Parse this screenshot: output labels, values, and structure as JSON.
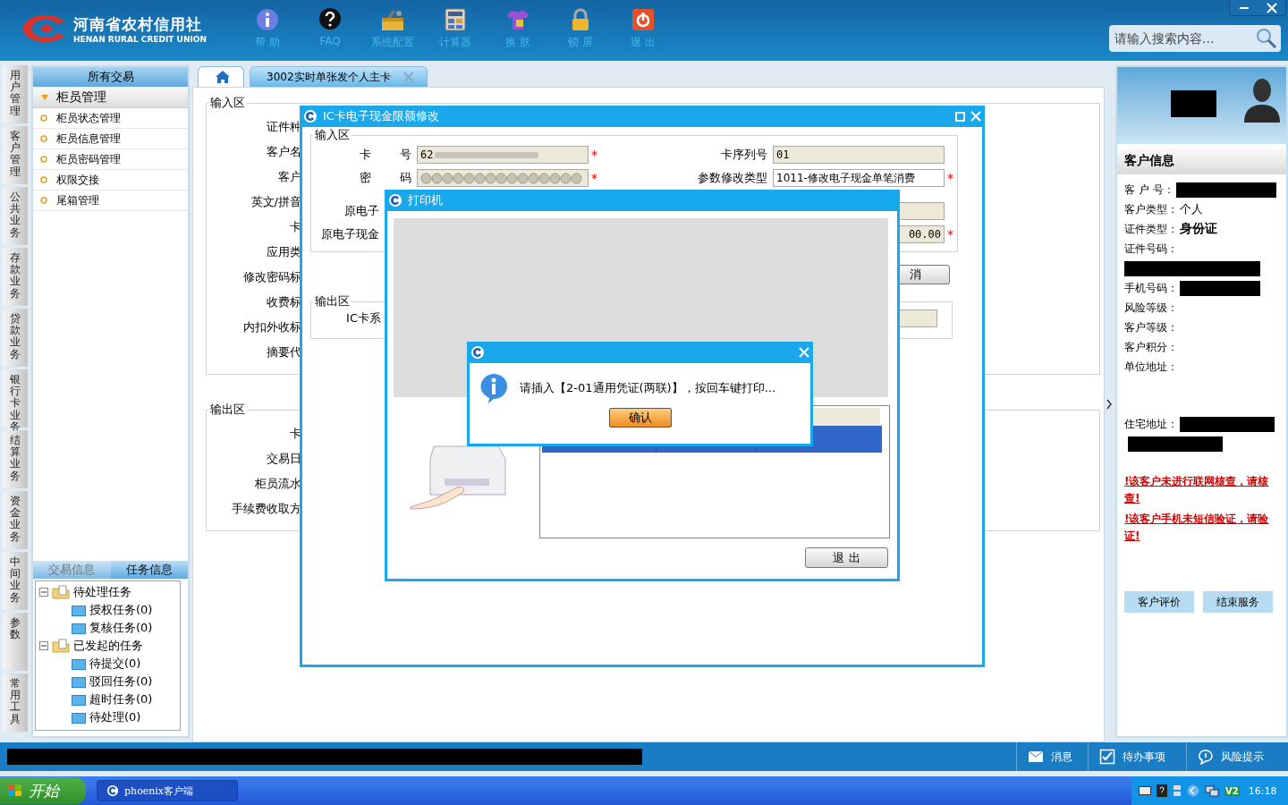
{
  "app": {
    "logo_cn": "河南省农村信用社",
    "logo_en": "HENAN RURAL CREDIT UNION"
  },
  "toolbar": [
    {
      "label": "帮 助",
      "kind": "info"
    },
    {
      "label": "FAQ",
      "kind": "faq"
    },
    {
      "label": "系统配置",
      "kind": "config"
    },
    {
      "label": "计算器",
      "kind": "calculator"
    },
    {
      "label": "换 肤",
      "kind": "skin"
    },
    {
      "label": "锁 屏",
      "kind": "lock"
    },
    {
      "label": "退 出",
      "kind": "exit"
    }
  ],
  "search": {
    "placeholder": "请输入搜索内容..."
  },
  "nav_tabs": [
    {
      "label": "用户管理"
    },
    {
      "label": "客户管理"
    },
    {
      "label": "公共业务"
    },
    {
      "label": "存款业务"
    },
    {
      "label": "贷款业务"
    },
    {
      "label": "银行卡业务"
    },
    {
      "label": "结算业务"
    },
    {
      "label": "资金业务"
    },
    {
      "label": "中间业务"
    },
    {
      "label": "参数"
    },
    {
      "label": "常用工具"
    }
  ],
  "sidebar": {
    "title": "所有交易",
    "groups": [
      {
        "label": "柜员管理",
        "expanded": true,
        "items": [
          {
            "label": "柜员状态管理"
          },
          {
            "label": "柜员信息管理"
          },
          {
            "label": "柜员密码管理"
          },
          {
            "label": "权限交接"
          },
          {
            "label": "尾箱管理"
          }
        ]
      }
    ]
  },
  "task_panel": {
    "tabs": [
      {
        "label": "交易信息",
        "selected": false
      },
      {
        "label": "任务信息",
        "selected": true
      }
    ],
    "tree": [
      {
        "label": "待处理任务",
        "expanded": true,
        "children": [
          {
            "label": "授权任务(0)"
          },
          {
            "label": "复核任务(0)"
          }
        ]
      },
      {
        "label": "已发起的任务",
        "expanded": true,
        "children": [
          {
            "label": "待提交(0)"
          },
          {
            "label": "驳回任务(0)"
          },
          {
            "label": "超时任务(0)"
          },
          {
            "label": "待处理(0)"
          }
        ]
      }
    ]
  },
  "doc_tabs": [
    {
      "kind": "home",
      "selected": false
    },
    {
      "kind": "page",
      "label": "3002实时单张发个人主卡",
      "selected": true
    }
  ],
  "form": {
    "input_legend": "输入区",
    "input_labels": [
      "证件种",
      "客户名",
      "客户",
      "英文/拼音",
      "卡",
      "应用类",
      "修改密码标",
      "收费标",
      "内扣外收标",
      "摘要代"
    ],
    "output_legend": "输出区",
    "output_labels": [
      "卡",
      "交易日",
      "柜员流水",
      "手续费收取方"
    ]
  },
  "card_dialog": {
    "title": "IC卡电子现金限额修改",
    "input_legend": "输入区",
    "fields": [
      {
        "label": "卡 号",
        "spaced": true,
        "kind": "blurred",
        "value": "62",
        "required": "*"
      },
      {
        "label": "卡序列号",
        "kind": "text",
        "value": "01"
      },
      {
        "label": "密 码",
        "spaced": true,
        "kind": "password",
        "required": "*"
      },
      {
        "label": "参数修改类型",
        "kind": "select",
        "value": "1011-修改电子现金单笔消费",
        "required": "*"
      },
      {
        "label": "原电子",
        "kind": "label_only"
      },
      {
        "kind": "text"
      },
      {
        "label": "原电子现金",
        "kind": "label_only"
      },
      {
        "kind": "amount",
        "value": "00.00",
        "required": "*"
      }
    ],
    "button": "消",
    "output_legend": "输出区",
    "output_label": "IC卡系"
  },
  "printer_dialog": {
    "title": "打印机",
    "list_rows": [
      {
        "selected": true
      }
    ],
    "exit_button": "退 出"
  },
  "message_box": {
    "message": "请插入【2-01通用凭证(两联)】，按回车键打印...",
    "ok_button": "确认"
  },
  "customer": {
    "title": "客户信息",
    "rows": [
      {
        "label": "客 户 号：",
        "kind": "redacted"
      },
      {
        "label": "客户类型：",
        "kind": "plain",
        "value": "个人"
      },
      {
        "label": "证件类型：",
        "kind": "bold",
        "value": "身份证"
      },
      {
        "label": "证件号码：",
        "kind": "redacted_below"
      },
      {
        "label": "手机号码：",
        "kind": "redacted"
      },
      {
        "label": "风险等级：",
        "kind": "blank"
      },
      {
        "label": "客户等级：",
        "kind": "blank"
      },
      {
        "label": "客户积分：",
        "kind": "blank"
      },
      {
        "label": "单位地址：",
        "kind": "blank_tall"
      },
      {
        "label": "住宅地址：",
        "kind": "redacted_two"
      }
    ],
    "warnings": [
      "!该客户未进行联网核查，请核查!",
      "!该客户手机未短信验证，请验证!"
    ],
    "buttons": [
      "客户评价",
      "结束服务"
    ]
  },
  "status_bar": {
    "buttons": [
      {
        "label": "消息",
        "kind": "mail"
      },
      {
        "label": "待办事项",
        "kind": "todo"
      },
      {
        "label": "风险提示",
        "kind": "risk"
      }
    ]
  },
  "taskbar": {
    "start": "开始",
    "tasks": [
      {
        "label": "phoenix客户端"
      }
    ],
    "tray_badge": "V2",
    "clock": "16:18"
  }
}
